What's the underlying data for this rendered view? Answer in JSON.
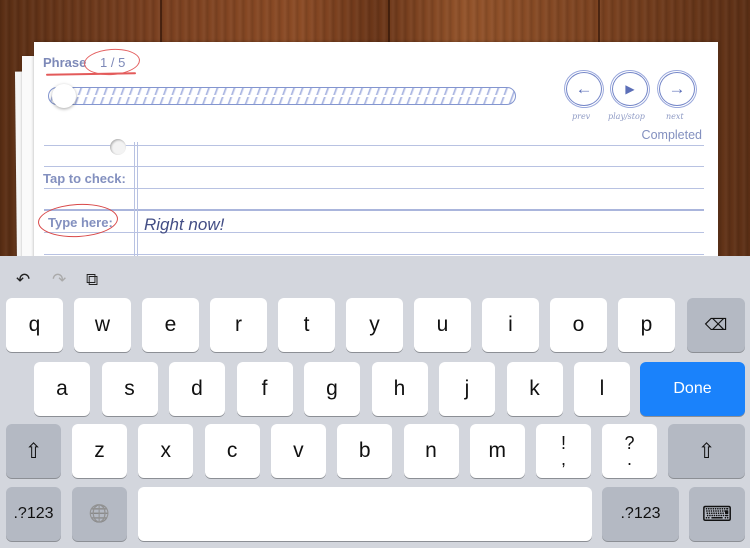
{
  "flashcard": {
    "phrase_label": "Phrase",
    "phrase_counter": "1 / 5",
    "progress_fraction": 0.0,
    "nav": [
      {
        "name": "prev",
        "icon": "arrow-left-icon",
        "glyph": "←",
        "caption": "prev"
      },
      {
        "name": "play-stop",
        "icon": "play-icon",
        "glyph": "▶",
        "caption": "play/stop"
      },
      {
        "name": "next",
        "icon": "arrow-right-icon",
        "glyph": "→",
        "caption": "next"
      }
    ],
    "status": "Completed",
    "tap_to_check_label": "Tap to check:",
    "type_here_label": "Type here:",
    "answer_value": "Right now!"
  },
  "keyboard": {
    "toolbar": {
      "undo": "↶",
      "redo": "↷",
      "paste": "⧉"
    },
    "row1": [
      "q",
      "w",
      "e",
      "r",
      "t",
      "y",
      "u",
      "i",
      "o",
      "p"
    ],
    "row2": [
      "a",
      "s",
      "d",
      "f",
      "g",
      "h",
      "j",
      "k",
      "l"
    ],
    "row3": [
      "z",
      "x",
      "c",
      "v",
      "b",
      "n",
      "m"
    ],
    "punct1": {
      "top": "!",
      "bottom": ","
    },
    "punct2": {
      "top": "?",
      "bottom": "."
    },
    "backspace_glyph": "⌫",
    "shift_glyph": "⇧",
    "done_label": "Done",
    "numbers_label": ".?123",
    "globe_glyph": "🌐",
    "hide_keyboard_glyph": "⌨"
  }
}
